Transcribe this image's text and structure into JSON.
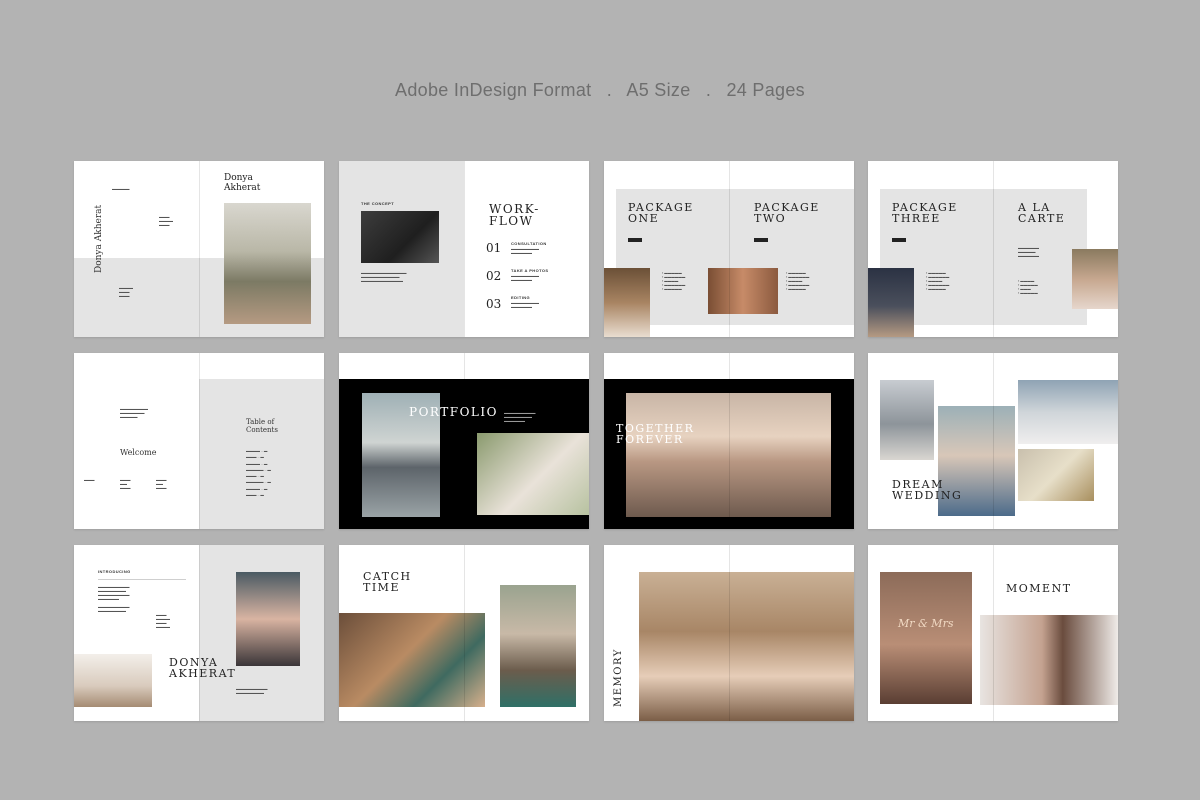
{
  "header": {
    "format": "Adobe InDesign Format",
    "size": "A5 Size",
    "pages": "24 Pages",
    "separator": "."
  },
  "spreads": {
    "s1": {
      "name_vertical": "Donya Akherat",
      "name_title": "Donya\nAkherat"
    },
    "s2": {
      "title": "WORK-\nFLOW",
      "concept": "THE CONCEPT",
      "steps": [
        "01",
        "02",
        "03"
      ],
      "step_labels": [
        "CONSULTATION",
        "TAKE A PHOTOS",
        "EDITING"
      ]
    },
    "s3": {
      "left_title": "PACKAGE\nONE",
      "right_title": "PACKAGE\nTWO"
    },
    "s4": {
      "left_title": "PACKAGE\nTHREE",
      "right_title": "A LA\nCARTE"
    },
    "s5": {
      "welcome": "Welcome",
      "toc": "Table of\nContents"
    },
    "s6": {
      "title": "PORTFOLIO"
    },
    "s7": {
      "title": "TOGETHER\nFOREVER"
    },
    "s8": {
      "title": "DREAM\nWEDDING"
    },
    "s9": {
      "title": "DONYA\nAKHERAT",
      "intro": "INTRODUCING"
    },
    "s10": {
      "title": "CATCH\nTIME"
    },
    "s11": {
      "title": "MEMORY"
    },
    "s12": {
      "title": "MOMENT",
      "badge": "Mr & Mrs"
    }
  },
  "colors": {
    "background": "#b3b3b3",
    "page": "#ffffff",
    "panel_gray": "#e4e4e4",
    "black": "#000000",
    "text_dark": "#222222"
  }
}
